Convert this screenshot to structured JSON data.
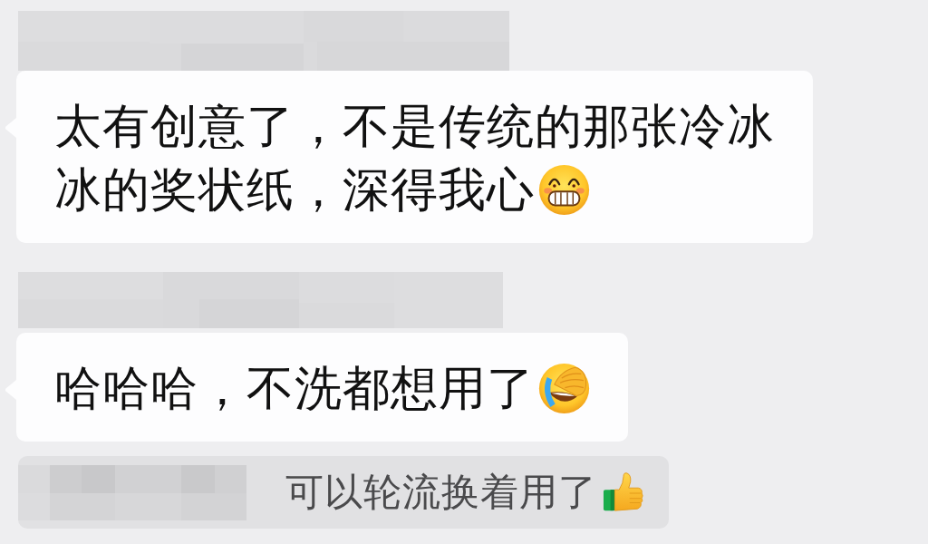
{
  "messages": [
    {
      "lines": [
        "太有创意了，不是传统的那张冷冰",
        "冰的奖状纸，深得我心"
      ]
    },
    {
      "lines": [
        "哈哈哈，不洗都想用了"
      ]
    }
  ],
  "quote": {
    "text": "可以轮流换着用了"
  }
}
